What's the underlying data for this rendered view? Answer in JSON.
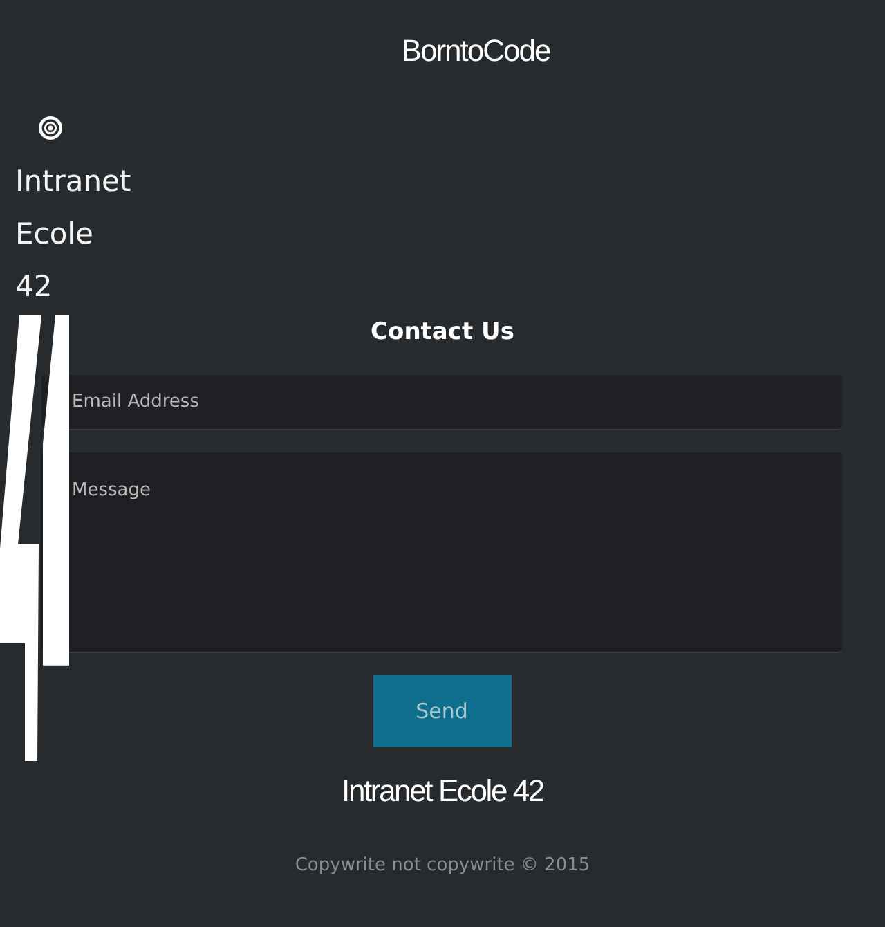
{
  "header": {
    "title": "BorntoCode"
  },
  "sidebar": {
    "brand": "Intranet Ecole 42"
  },
  "contact_form": {
    "heading": "Contact Us",
    "fields": [
      {
        "kind": "input",
        "placeholder": "Email Address"
      },
      {
        "kind": "textarea",
        "placeholder": "Message"
      }
    ],
    "submit": "Send"
  },
  "footer": {
    "title": "Intranet Ecole 42",
    "copyright": "Copywrite not copywrite © 2015"
  }
}
